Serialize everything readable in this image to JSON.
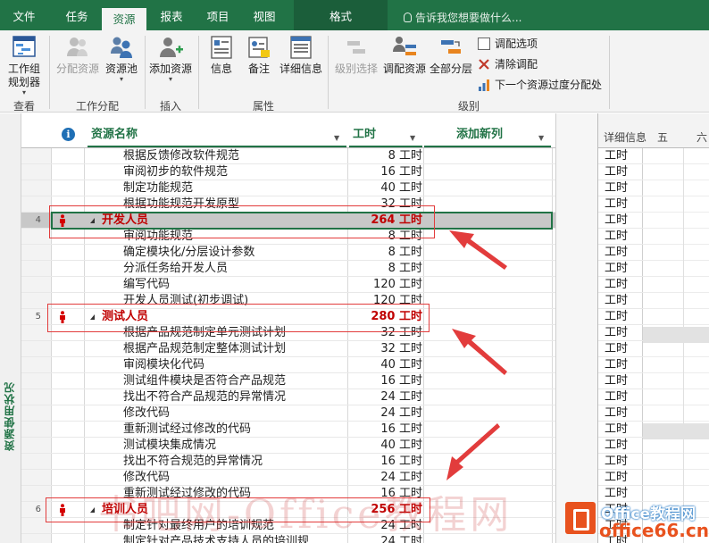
{
  "menu": {
    "tabs": [
      "文件",
      "任务",
      "资源",
      "报表",
      "项目",
      "视图"
    ],
    "active": "资源",
    "tools_tab": "格式",
    "tell_me": "告诉我您想要做什么..."
  },
  "ribbon": {
    "groups": {
      "view": "查看",
      "assign": "工作分配",
      "insert": "插入",
      "props": "属性",
      "level": "级别"
    },
    "team_planner": "工作组\n规划器",
    "assign_resources": "分配资源",
    "resource_pool": "资源池",
    "add_resources": "添加资源",
    "info": "信息",
    "notes": "备注",
    "details": "详细信息",
    "level_selection": "级别选择",
    "level_resource": "调配资源",
    "level_all": "全部分层",
    "leveling_options": "调配选项",
    "clear_leveling": "清除调配",
    "next_overallocation": "下一个资源过度分配处"
  },
  "sidebar": {
    "view_label": "资源使用状况"
  },
  "grid": {
    "headers": {
      "name": "资源名称",
      "work": "工时",
      "add_column": "添加新列"
    },
    "rows": [
      {
        "type": "task",
        "num": "",
        "name": "根据反馈修改软件规范",
        "work": "8 工时"
      },
      {
        "type": "task",
        "num": "",
        "name": "审阅初步的软件规范",
        "work": "16 工时"
      },
      {
        "type": "task",
        "num": "",
        "name": "制定功能规范",
        "work": "40 工时"
      },
      {
        "type": "task",
        "num": "",
        "name": "根据功能规范开发原型",
        "work": "32 工时"
      },
      {
        "type": "group",
        "num": "4",
        "name": "开发人员",
        "work": "264 工时"
      },
      {
        "type": "task",
        "num": "",
        "name": "审阅功能规范",
        "work": "8 工时"
      },
      {
        "type": "task",
        "num": "",
        "name": "确定模块化/分层设计参数",
        "work": "8 工时"
      },
      {
        "type": "task",
        "num": "",
        "name": "分派任务给开发人员",
        "work": "8 工时"
      },
      {
        "type": "task",
        "num": "",
        "name": "编写代码",
        "work": "120 工时"
      },
      {
        "type": "task",
        "num": "",
        "name": "开发人员测试(初步调试)",
        "work": "120 工时"
      },
      {
        "type": "group",
        "num": "5",
        "name": "测试人员",
        "work": "280 工时"
      },
      {
        "type": "task",
        "num": "",
        "name": "根据产品规范制定单元测试计划",
        "work": "32 工时"
      },
      {
        "type": "task",
        "num": "",
        "name": "根据产品规范制定整体测试计划",
        "work": "32 工时"
      },
      {
        "type": "task",
        "num": "",
        "name": "审阅模块化代码",
        "work": "40 工时"
      },
      {
        "type": "task",
        "num": "",
        "name": "测试组件模块是否符合产品规范",
        "work": "16 工时"
      },
      {
        "type": "task",
        "num": "",
        "name": "找出不符合产品规范的异常情况",
        "work": "24 工时"
      },
      {
        "type": "task",
        "num": "",
        "name": "修改代码",
        "work": "24 工时"
      },
      {
        "type": "task",
        "num": "",
        "name": "重新测试经过修改的代码",
        "work": "16 工时"
      },
      {
        "type": "task",
        "num": "",
        "name": "测试模块集成情况",
        "work": "40 工时"
      },
      {
        "type": "task",
        "num": "",
        "name": "找出不符合规范的异常情况",
        "work": "16 工时"
      },
      {
        "type": "task",
        "num": "",
        "name": "修改代码",
        "work": "24 工时"
      },
      {
        "type": "task",
        "num": "",
        "name": "重新测试经过修改的代码",
        "work": "16 工时"
      },
      {
        "type": "group",
        "num": "6",
        "name": "培训人员",
        "work": "256 工时"
      },
      {
        "type": "task",
        "num": "",
        "name": "制定针对最终用户的培训规范",
        "work": "24 工时"
      },
      {
        "type": "task",
        "num": "",
        "name": "制定针对产品技术支持人员的培训规",
        "work": "24 工时"
      }
    ]
  },
  "detail": {
    "header": "详细信息",
    "days": [
      "五",
      "六"
    ],
    "cell": "工时",
    "rows": 25
  },
  "watermark": {
    "text": "书吧网-Office教程网",
    "logo_top": "Office教程网",
    "logo_bottom": "office66.cn"
  },
  "colors": {
    "accent": "#217346",
    "group_text": "#c00000",
    "annotation": "#e23c3c"
  }
}
